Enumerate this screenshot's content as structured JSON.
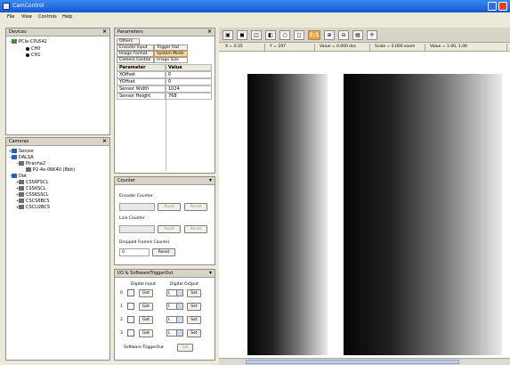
{
  "window": {
    "title": "CamControl"
  },
  "menu": [
    "File",
    "View",
    "Controls",
    "Help"
  ],
  "devices": {
    "title": "Devices",
    "items": [
      {
        "label": "PCIe-CPL642",
        "indent": 0
      },
      {
        "label": "CH0",
        "indent": 2
      },
      {
        "label": "CH1",
        "indent": 2
      }
    ]
  },
  "cameras": {
    "title": "Cameras",
    "items": [
      {
        "label": "Sensor",
        "indent": 0
      },
      {
        "label": "DALSA",
        "indent": 0
      },
      {
        "label": "Piranha2",
        "indent": 1
      },
      {
        "label": "P2-4x-06K40 (8bit)",
        "indent": 2
      },
      {
        "label": "Dot",
        "indent": 0
      },
      {
        "label": "CSS6FSCL",
        "indent": 1
      },
      {
        "label": "CSS6SCL",
        "indent": 1
      },
      {
        "label": "CSS6SSCL",
        "indent": 1
      },
      {
        "label": "CSCS6BCS",
        "indent": 1
      },
      {
        "label": "CSCU2BCS",
        "indent": 1
      }
    ]
  },
  "parameters": {
    "title": "Parameters",
    "tabs": [
      {
        "label": "Others"
      },
      {
        "label": "Encoder Input"
      },
      {
        "label": "Trigger Out"
      },
      {
        "label": "Image Format"
      },
      {
        "label": "System Mode"
      },
      {
        "label": "Camera Control"
      },
      {
        "label": "Image Size"
      }
    ],
    "columns": [
      "Parameter",
      "Value"
    ],
    "rows": [
      {
        "name": "XOffset",
        "value": "0"
      },
      {
        "name": "YOffset",
        "value": "0"
      },
      {
        "name": "Sensor Width",
        "value": "1024"
      },
      {
        "name": "Sensor Height",
        "value": "768"
      }
    ]
  },
  "counter": {
    "title": "Counter",
    "encoder_label": "Encoder Counter",
    "line_label": "Line Counter",
    "dropped_label": "Dropped Frames Counter",
    "read": "Read",
    "reset": "Reset",
    "dropped_value": "0"
  },
  "io": {
    "title": "I/O & SoftwareTriggerOut",
    "digital_input": "Digital Input",
    "digital_output": "Digital Output",
    "get": "Get",
    "set": "Set",
    "level": "L",
    "rows": [
      "0",
      "1",
      "2",
      "3"
    ],
    "software_trigger": "Software TriggerOut",
    "sw_set": "Set"
  },
  "toolbar": {
    "zoom_one": "1:1"
  },
  "status": {
    "f1": "X = 0.35",
    "f2": "Y = 197",
    "f3": "Value = 0.000 dec",
    "f4": "Scale = 0.000 zoom",
    "f5": "Value = 1.00, 1.00"
  },
  "colors": {
    "accent": "#f0a030",
    "titlebar": "#1557d4"
  }
}
